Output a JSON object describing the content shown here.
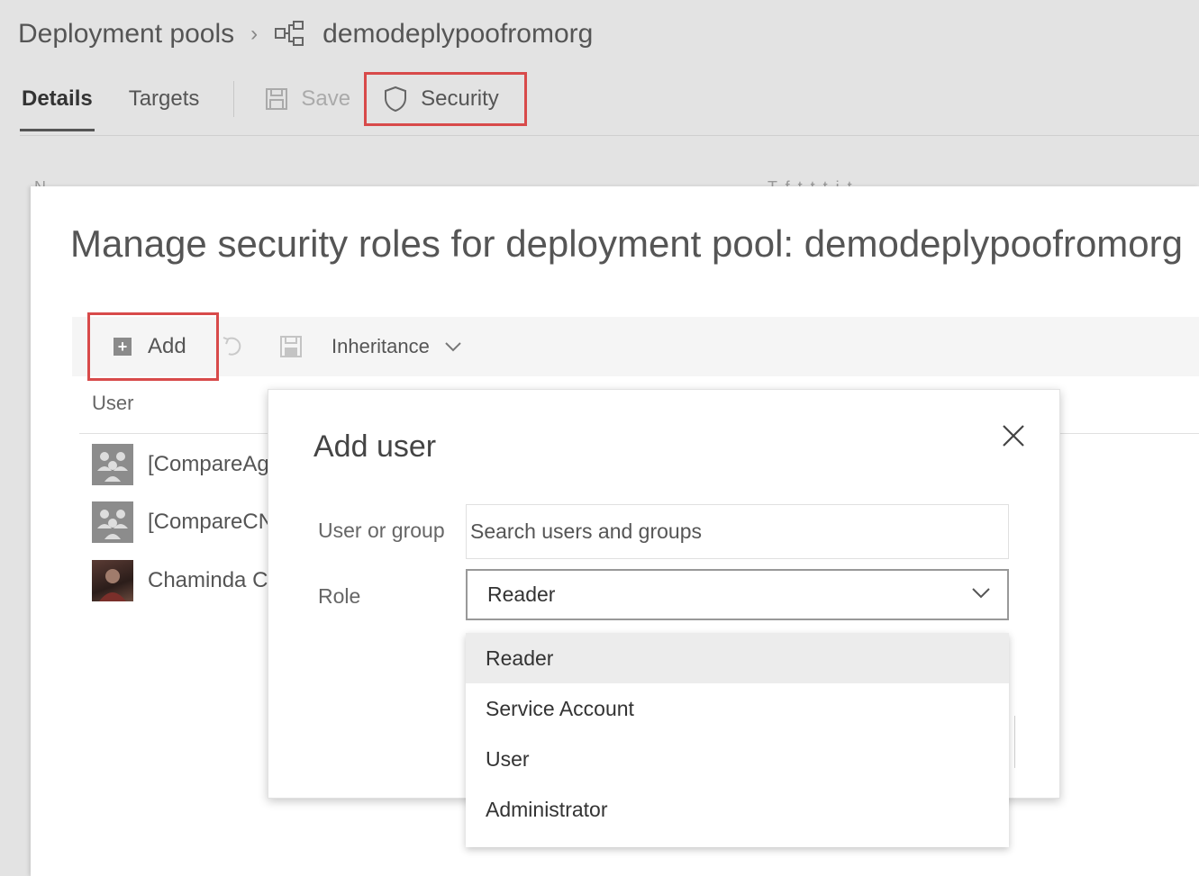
{
  "breadcrumb": {
    "root": "Deployment pools",
    "separator": ">",
    "pool_name": "demodeplypoofromorg"
  },
  "tabs": [
    {
      "label": "Details",
      "active": true
    },
    {
      "label": "Targets",
      "active": false
    }
  ],
  "toolbar": {
    "save_label": "Save",
    "security_label": "Security"
  },
  "background_ghost": {
    "left": "N",
    "right": "T    f t    t t    i t"
  },
  "panel": {
    "title": "Manage security roles for deployment pool: demodeplypoofromorg",
    "add_label": "Add",
    "inheritance_label": "Inheritance",
    "column_user": "User",
    "users": [
      {
        "name": "[CompareAg",
        "avatar": "group-icon"
      },
      {
        "name": "[CompareCN",
        "avatar": "group-icon"
      },
      {
        "name": "Chaminda C",
        "avatar": "photo"
      }
    ]
  },
  "dialog": {
    "title": "Add user",
    "user_or_group_label": "User or group",
    "search_placeholder": "Search users and groups",
    "role_label": "Role",
    "role_value": "Reader"
  },
  "role_options": [
    {
      "label": "Reader",
      "selected": true
    },
    {
      "label": "Service Account",
      "selected": false
    },
    {
      "label": "User",
      "selected": false
    },
    {
      "label": "Administrator",
      "selected": false
    }
  ],
  "colors": {
    "highlight_box": "#d84a4a",
    "selected_option_bg": "#ececec"
  }
}
